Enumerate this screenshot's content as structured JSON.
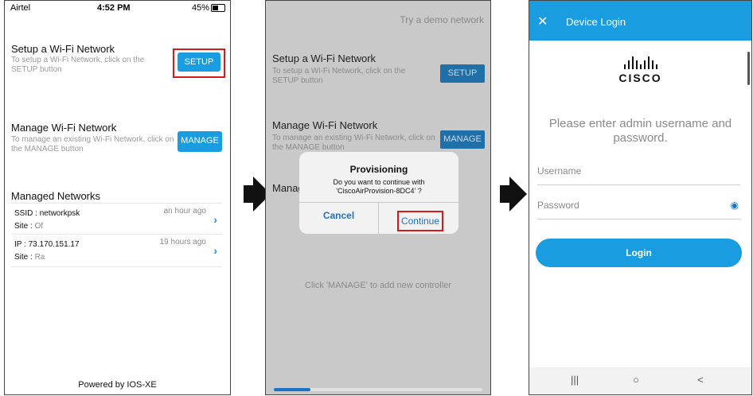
{
  "phone1": {
    "status": {
      "carrier": "Airtel",
      "time": "4:52 PM",
      "battery": "45%"
    },
    "setup": {
      "title": "Setup a Wi-Fi Network",
      "subtitle": "To setup a Wi-Fi Network, click on the SETUP button",
      "button": "SETUP"
    },
    "manage": {
      "title": "Manage Wi-Fi Network",
      "subtitle": "To manage an existing Wi-Fi Network, click on the MANAGE button",
      "button": "MANAGE"
    },
    "managed": {
      "heading": "Managed Networks",
      "rows": [
        {
          "line1_key": "SSID :",
          "line1_val": "networkpsk",
          "line2_key": "Site :",
          "line2_val": "Of",
          "time": "an hour ago"
        },
        {
          "line1_key": "IP :",
          "line1_val": "73.170.151.17",
          "line2_key": "Site :",
          "line2_val": "Ra",
          "time": "19 hours ago"
        }
      ]
    },
    "footer": "Powered by IOS-XE"
  },
  "phone2": {
    "demo": "Try a demo network",
    "setup": {
      "title": "Setup a Wi-Fi Network",
      "subtitle": "To setup a Wi-Fi Network, click on the SETUP button",
      "button": "SETUP"
    },
    "manage": {
      "title": "Manage Wi-Fi Network",
      "subtitle": "To manage an existing Wi-Fi Network, click on the MANAGE button",
      "button": "MANAGE"
    },
    "partial_heading": "Manag",
    "dialog": {
      "title": "Provisioning",
      "message_line1": "Do you want to continue with",
      "message_line2": "'CiscoAirProvision-8DC4' ?",
      "cancel": "Cancel",
      "continue": "Continue"
    },
    "hint": "Click 'MANAGE' to add new controller"
  },
  "phone3": {
    "appbar_title": "Device Login",
    "logo_word": "CISCO",
    "prompt": "Please enter admin username and password.",
    "username_placeholder": "Username",
    "password_placeholder": "Password",
    "login_button": "Login",
    "nav": {
      "recents": "|||",
      "home": "○",
      "back": "<"
    }
  },
  "colors": {
    "accent": "#1a9de0",
    "highlight": "#d31b1b",
    "dim_overlay": "#c9c9c9"
  }
}
